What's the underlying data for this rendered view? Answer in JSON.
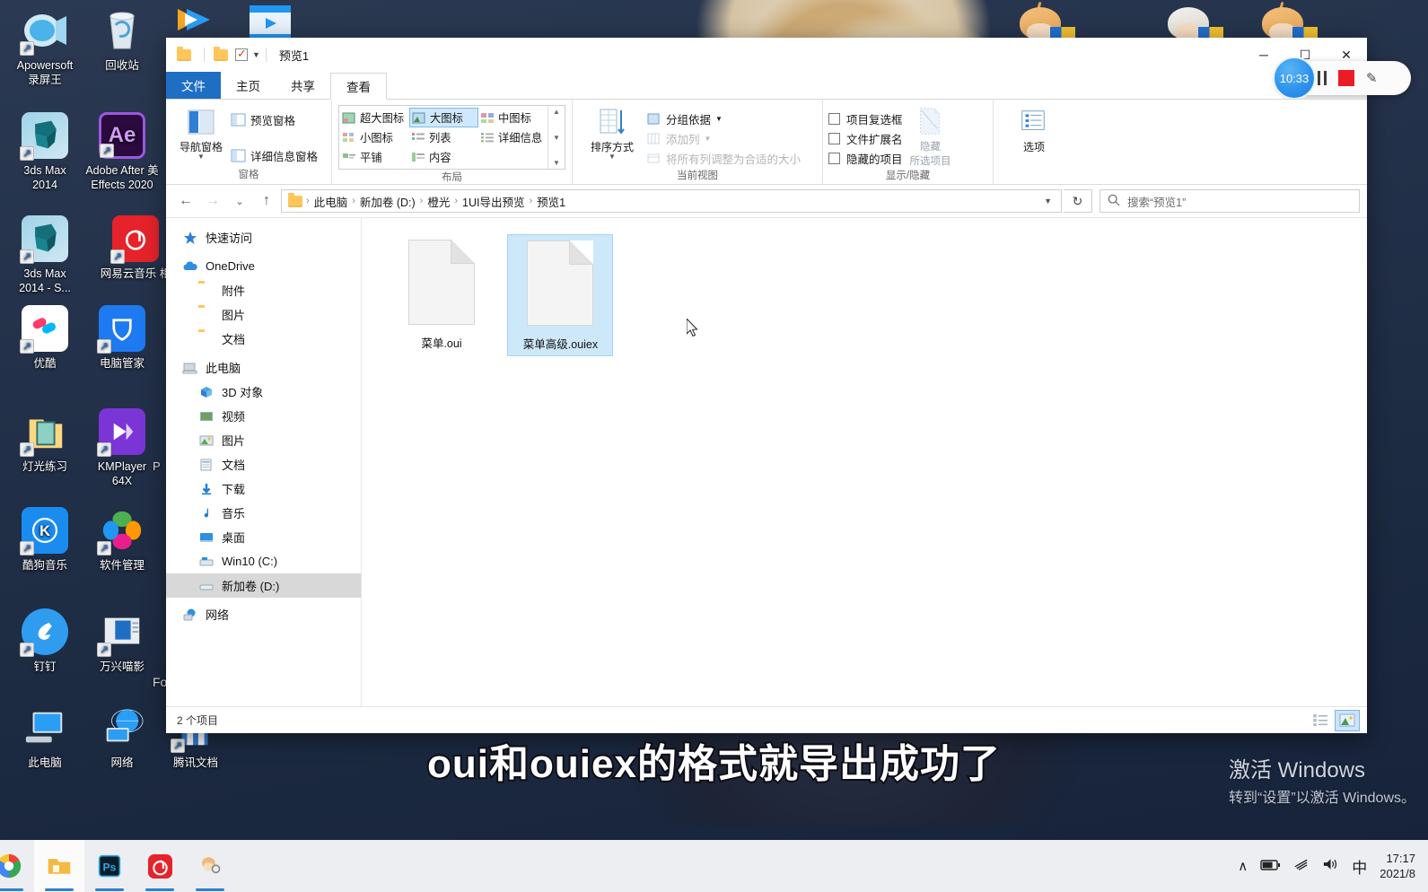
{
  "desktop": {
    "icons": [
      {
        "label": "Apowersoft\n录屏王",
        "name": "apowersoft-recorder",
        "icon": "camera-icon"
      },
      {
        "label": "回收站",
        "name": "recycle-bin",
        "icon": "trash-icon"
      },
      {
        "label": "3ds Max\n2014",
        "name": "3ds-max-2014",
        "icon": "3dsmax-icon"
      },
      {
        "label": "Adobe After 美\nEffects 2020",
        "name": "after-effects-2020",
        "icon": "ae-icon"
      },
      {
        "label": "3ds Max\n2014 - S...",
        "name": "3ds-max-2014-shortcut",
        "icon": "3dsmax-icon"
      },
      {
        "label": "网易云音乐  相",
        "name": "netease-music",
        "icon": "netease-icon"
      },
      {
        "label": "优酷",
        "name": "youku",
        "icon": "youku-icon"
      },
      {
        "label": "电脑管家",
        "name": "pc-manager",
        "icon": "shield-icon"
      },
      {
        "label": "灯光练习",
        "name": "lighting-practice",
        "icon": "folder-image-icon"
      },
      {
        "label": "KMPlayer\n64X",
        "name": "kmplayer-64x",
        "icon": "play-icon"
      },
      {
        "label": "酷狗音乐",
        "name": "kugou-music",
        "icon": "kugou-icon"
      },
      {
        "label": "软件管理",
        "name": "software-manager",
        "icon": "flower-icon"
      },
      {
        "label": "钉钉",
        "name": "dingtalk",
        "icon": "dingtalk-icon"
      },
      {
        "label": "万兴喵影",
        "name": "wondershare-filmora",
        "icon": "filmora-icon"
      },
      {
        "label": "此电脑",
        "name": "this-pc",
        "icon": "computer-icon"
      },
      {
        "label": "网络",
        "name": "network",
        "icon": "globe-icon"
      },
      {
        "label": "腾讯文档",
        "name": "tencent-docs",
        "icon": "tencent-docs-icon"
      }
    ],
    "partial_label": "Fo"
  },
  "window": {
    "title": "预览1",
    "controls": {
      "minimize": "─",
      "maximize": "☐",
      "close": "✕"
    },
    "tabs": [
      {
        "label": "文件",
        "name": "tab-file"
      },
      {
        "label": "主页",
        "name": "tab-home"
      },
      {
        "label": "共享",
        "name": "tab-share"
      },
      {
        "label": "查看",
        "name": "tab-view"
      }
    ],
    "active_tab": "查看"
  },
  "ribbon": {
    "groups": [
      {
        "name": "panes",
        "label": "窗格",
        "big": {
          "label": "导航窗格",
          "icon": "nav-pane-icon"
        },
        "items": [
          {
            "label": "预览窗格",
            "icon": "preview-pane-icon",
            "disabled": false
          },
          {
            "label": "详细信息窗格",
            "icon": "details-pane-icon",
            "disabled": false
          }
        ]
      },
      {
        "name": "layout",
        "label": "布局",
        "gallery": [
          {
            "label": "超大图标",
            "icon": "extra-large-icons-icon",
            "selected": false
          },
          {
            "label": "小图标",
            "icon": "small-icons-icon",
            "selected": false
          },
          {
            "label": "平铺",
            "icon": "tiles-icon",
            "selected": false
          },
          {
            "label": "大图标",
            "icon": "large-icons-icon",
            "selected": true
          },
          {
            "label": "列表",
            "icon": "list-icon",
            "selected": false
          },
          {
            "label": "内容",
            "icon": "content-icon",
            "selected": false
          },
          {
            "label": "中图标",
            "icon": "medium-icons-icon",
            "selected": false
          },
          {
            "label": "详细信息",
            "icon": "details-icon",
            "selected": false
          }
        ]
      },
      {
        "name": "current-view",
        "label": "当前视图",
        "big": {
          "label": "排序方式",
          "icon": "sort-by-icon"
        },
        "items": [
          {
            "label": "分组依据",
            "icon": "group-by-icon",
            "disabled": false,
            "dropdown": true
          },
          {
            "label": "添加列",
            "icon": "add-column-icon",
            "disabled": true,
            "dropdown": true
          },
          {
            "label": "将所有列调整为合适的大小",
            "icon": "fit-columns-icon",
            "disabled": true
          }
        ]
      },
      {
        "name": "show-hide",
        "label": "显示/隐藏",
        "checkboxes": [
          {
            "label": "项目复选框",
            "checked": false
          },
          {
            "label": "文件扩展名",
            "checked": false
          },
          {
            "label": "隐藏的项目",
            "checked": false
          }
        ],
        "big": {
          "label": "隐藏",
          "sublabel": "所选项目",
          "icon": "hide-selected-icon"
        }
      },
      {
        "name": "options",
        "label": "",
        "big": {
          "label": "选项",
          "icon": "options-icon"
        }
      }
    ]
  },
  "address": {
    "back": "←",
    "forward": "→",
    "recent": "⌄",
    "up": "↑",
    "crumbs": [
      "此电脑",
      "新加卷 (D:)",
      "橙光",
      "1UI导出预览",
      "预览1"
    ],
    "refresh": "↻",
    "search_placeholder": "搜索“预览1”"
  },
  "navpane": {
    "items": [
      {
        "label": "快速访问",
        "icon": "star-icon",
        "indent": false,
        "selected": false
      },
      {
        "label": "OneDrive",
        "icon": "cloud-icon",
        "indent": false,
        "selected": false
      },
      {
        "label": "附件",
        "icon": "folder-icon",
        "indent": true,
        "selected": false
      },
      {
        "label": "图片",
        "icon": "folder-icon",
        "indent": true,
        "selected": false
      },
      {
        "label": "文档",
        "icon": "folder-icon",
        "indent": true,
        "selected": false
      },
      {
        "label": "此电脑",
        "icon": "computer-icon",
        "indent": false,
        "selected": false
      },
      {
        "label": "3D 对象",
        "icon": "3d-objects-icon",
        "indent": true,
        "selected": false
      },
      {
        "label": "视频",
        "icon": "videos-icon",
        "indent": true,
        "selected": false
      },
      {
        "label": "图片",
        "icon": "pictures-icon",
        "indent": true,
        "selected": false
      },
      {
        "label": "文档",
        "icon": "documents-icon",
        "indent": true,
        "selected": false
      },
      {
        "label": "下载",
        "icon": "downloads-icon",
        "indent": true,
        "selected": false
      },
      {
        "label": "音乐",
        "icon": "music-icon",
        "indent": true,
        "selected": false
      },
      {
        "label": "桌面",
        "icon": "desktop-icon",
        "indent": true,
        "selected": false
      },
      {
        "label": "Win10 (C:)",
        "icon": "drive-icon",
        "indent": true,
        "selected": false
      },
      {
        "label": "新加卷 (D:)",
        "icon": "drive-icon",
        "indent": true,
        "selected": true
      },
      {
        "label": "网络",
        "icon": "network-icon",
        "indent": false,
        "selected": false
      }
    ]
  },
  "files": [
    {
      "name": "菜单.oui",
      "selected": false,
      "icon": "generic-file-icon"
    },
    {
      "name": "菜单高级.ouiex",
      "selected": true,
      "icon": "generic-file-icon"
    }
  ],
  "statusbar": {
    "count": "2 个项目",
    "views": [
      {
        "name": "details-view-button",
        "active": false
      },
      {
        "name": "large-icons-view-button",
        "active": true
      }
    ]
  },
  "recorder": {
    "timer": "10:33",
    "pause": "pause-icon",
    "stop": "stop-icon",
    "pen": "✎"
  },
  "subtitle": "oui和ouiex的格式就导出成功了",
  "activate": {
    "line1": "激活 Windows",
    "line2": "转到“设置”以激活 Windows。"
  },
  "taskbar": {
    "items": [
      {
        "name": "taskbar-chrome",
        "icon": "chrome-icon"
      },
      {
        "name": "taskbar-file-explorer",
        "icon": "folder-icon",
        "active": true
      },
      {
        "name": "taskbar-photoshop",
        "icon": "ps-icon"
      },
      {
        "name": "taskbar-netease-music",
        "icon": "netease-icon"
      },
      {
        "name": "taskbar-chibi",
        "icon": "chibi-icon"
      }
    ],
    "tray": [
      "∧",
      "battery-icon",
      "wifi-icon",
      "volume-icon",
      "中"
    ],
    "clock_time": "17:17",
    "clock_date": "2021/8"
  },
  "colors": {
    "accent": "#1e6fc4",
    "selection": "#cde8f9",
    "record_red": "#ed1c24"
  }
}
